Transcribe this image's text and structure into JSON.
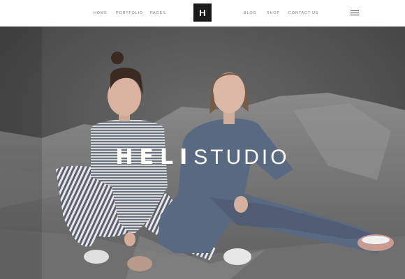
{
  "nav": {
    "left": [
      "HOME",
      "PORTFOLIO",
      "PAGES"
    ],
    "right": [
      "BLOG",
      "SHOP",
      "CONTACT US"
    ],
    "logo_letter": "H"
  },
  "hero": {
    "title_bold": "HELI",
    "title_light": "STUDIO"
  },
  "icons": {
    "menu": "hamburger-menu-icon"
  },
  "colors": {
    "header_bg": "#ffffff",
    "logo_bg": "#1b1b1b",
    "hero_bg": "#4b4b4b",
    "nav_text": "#7a7a7a"
  }
}
